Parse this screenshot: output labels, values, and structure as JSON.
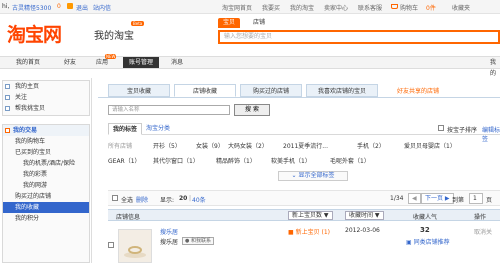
{
  "topbar": {
    "greeting": "hi,",
    "username": "古灵精怪5300",
    "message_count": "0",
    "logout": "退出",
    "inbox": "站内信",
    "links": [
      "淘宝网首页",
      "我要买",
      "我的淘宝",
      "卖家中心",
      "联系客服",
      "购物车",
      "收藏夹"
    ],
    "cart_count": "0件"
  },
  "header": {
    "logo": "淘宝网",
    "subtitle": "我的淘宝",
    "beta": "Beta",
    "search_tab_baby": "宝贝",
    "search_tab_shop": "店铺",
    "search_placeholder": "输入您想要的宝贝"
  },
  "nav": {
    "items": [
      "我的首页",
      "好友",
      "应用",
      "账号管理",
      "消息"
    ],
    "app_badge": "NEW",
    "right_text": "我的"
  },
  "sidebar": {
    "group1": [
      "我的主页",
      "关注",
      "帮我挑宝贝"
    ],
    "group2_head": "我的交易",
    "group2": [
      "我的购物车",
      "已买到的宝贝",
      "我的机票/酒店/保险",
      "我的彩票",
      "我的网游",
      "购买过的店铺",
      "我的收藏",
      "我的积分"
    ]
  },
  "main": {
    "tabs": [
      "宝贝收藏",
      "店铺收藏",
      "购买过的店铺",
      "我喜欢店铺的宝贝",
      "好友共享的店铺"
    ],
    "name_placeholder": "请输入名称",
    "search_button": "搜 索",
    "tag_tab_mine": "我的标签",
    "tag_tab_taobao": "淘宝分类",
    "sort_by_update": "按宝子排序",
    "edit_tags": "编辑标签",
    "tags_row1": [
      "所有店铺",
      "开衫（5）",
      "女装（9）",
      "大码女装（2）",
      "2011夏季流行...",
      "手机（2）",
      "爱贝贝母婴店（1）"
    ],
    "tags_row2": [
      "GEAR（1）",
      "其代尔窗口（1）",
      "精品醉饰（1）",
      "软美手机（1）",
      "毛呢外套（1）"
    ],
    "show_all_tags": "显示全部标签",
    "select_all": "全选",
    "delete": "删除",
    "show_label": "显示:",
    "page_size_20": "20",
    "page_size_40": "40条",
    "page_info": "1/34",
    "next_page": "下一页",
    "page_label": "到第",
    "page_input": "1",
    "page_unit": "页",
    "header_shop_info": "店铺信息",
    "header_latest": "新上宝贝数",
    "header_collect_time": "收藏时间",
    "header_popularity": "收藏人气",
    "header_action": "操作",
    "row1_shop": "搜乐居",
    "row1_seller": "搜乐居",
    "row1_wangwang": "和我联系",
    "row1_latest": "新上宝贝 (1)",
    "row1_date": "2012-03-06",
    "row1_popularity": "32",
    "row1_recommend": "同类店铺推荐",
    "row1_cancel": "取消关",
    "row1_checkbox_label": ""
  }
}
